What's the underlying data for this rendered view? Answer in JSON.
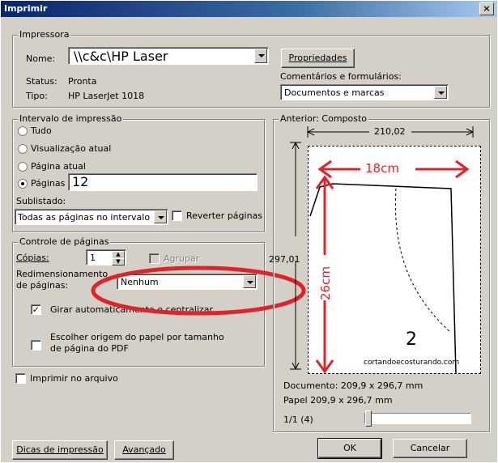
{
  "window": {
    "title": "Imprimir",
    "close_glyph": "×"
  },
  "printer": {
    "legend": "Impressora",
    "name_label": "Nome:",
    "name_value": "\\\\c&c\\HP Laser",
    "status_label": "Status:",
    "status_value": "Pronta",
    "type_label": "Tipo:",
    "type_value": "HP LaserJet 1018",
    "properties_button": "Propriedades",
    "comments_label": "Comentários e formulários:",
    "comments_value": "Documentos e marcas"
  },
  "range": {
    "legend": "Intervalo de impressão",
    "options": [
      "Tudo",
      "Visualização atual",
      "Página atual",
      "Páginas"
    ],
    "selected": "Páginas",
    "pages_value": "12",
    "subset_label": "Sublistado:",
    "subset_value": "Todas as páginas no intervalo",
    "reverse_label": "Reverter páginas"
  },
  "handling": {
    "legend": "Controle de páginas",
    "copies_label": "Cópias:",
    "copies_value": "1",
    "collate_label": "Agrupar",
    "scaling_label_1": "Redimensionamento",
    "scaling_label_2": "de páginas:",
    "scaling_value": "Nenhum",
    "autorotate_label": "Girar automaticamente e centralizar",
    "autorotate_checked": true,
    "choose_source_label_1": "Escolher origem do papel por tamanho",
    "choose_source_label_2": "de página do PDF"
  },
  "print_to_file_label": "Imprimir no arquivo",
  "preview": {
    "legend": "Anterior: Composto",
    "width_value": "210,02",
    "height_value": "297,01",
    "annotation_width": "18cm",
    "annotation_height": "26cm",
    "page_number": "2",
    "site_text": "cortandoecosturando.com",
    "document_size": "Documento: 209,9 x 296,7 mm",
    "paper_size": "Papel 209,9 x 296,7 mm",
    "page_counter": "1/1 (4)"
  },
  "buttons": {
    "tips": "Dicas de impressão",
    "advanced": "Avançado",
    "ok": "OK",
    "cancel": "Cancelar"
  },
  "colors": {
    "highlight": "#e0232a",
    "titlebar": "#0a246a"
  }
}
